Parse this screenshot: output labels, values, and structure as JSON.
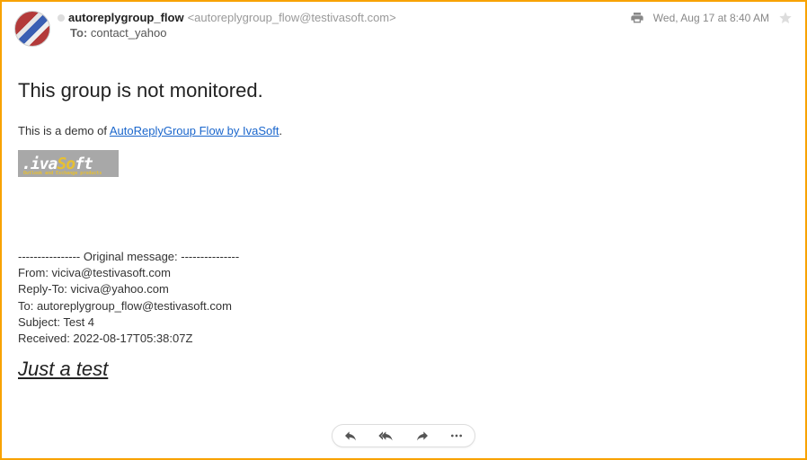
{
  "header": {
    "from_name": "autoreplygroup_flow",
    "from_email": "<autoreplygroup_flow@testivasoft.com>",
    "to_label": "To:",
    "to_value": "contact_yahoo",
    "date": "Wed, Aug 17 at 8:40 AM"
  },
  "body": {
    "title": "This group is not monitored.",
    "demo_prefix": "This is a demo of ",
    "demo_link": "AutoReplyGroup Flow by IvaSoft",
    "demo_suffix": ".",
    "logo_text_iva": ".iva",
    "logo_text_so": "So",
    "logo_text_ft": "ft",
    "logo_sub": "Outlook and Exchange products"
  },
  "original": {
    "divider": "---------------- Original message: ---------------",
    "from": "From: viciva@testivasoft.com",
    "reply_to": "Reply-To: viciva@yahoo.com",
    "to": "To:  autoreplygroup_flow@testivasoft.com",
    "subject": "Subject: Test 4",
    "received": "Received: 2022-08-17T05:38:07Z",
    "body_text": "Just a test"
  }
}
